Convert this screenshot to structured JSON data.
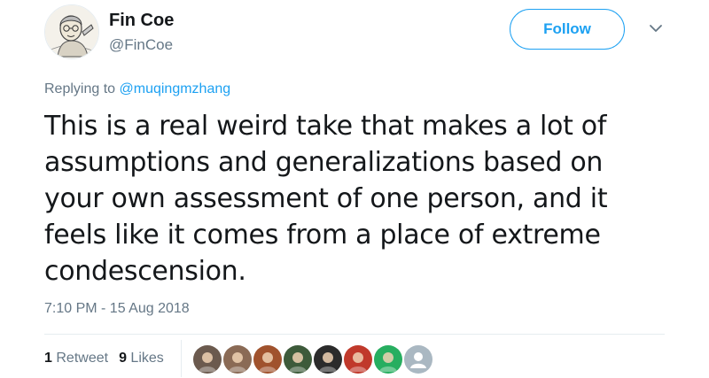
{
  "author": {
    "name": "Fin Coe",
    "handle": "@FinCoe",
    "avatar_icon": "sketched-portrait-avatar"
  },
  "follow_label": "Follow",
  "menu_icon": "chevron-down-icon",
  "reply": {
    "prefix": "Replying to",
    "to": "@muqingmzhang"
  },
  "tweet_text": "This is a real weird take that makes a lot of assumptions and generalizations based on your own assessment of one person, and it feels like it comes from a place of extreme condescension.",
  "timestamp": "7:10 PM - 15 Aug 2018",
  "stats": {
    "retweet_count": "1",
    "retweet_label": "Retweet",
    "like_count": "9",
    "like_label": "Likes"
  },
  "likers": [
    {
      "name": "liker-avatar-1",
      "color": "#6b5a4e"
    },
    {
      "name": "liker-avatar-2",
      "color": "#8a6a55"
    },
    {
      "name": "liker-avatar-3",
      "color": "#a0522d"
    },
    {
      "name": "liker-avatar-4",
      "color": "#3d5a3a"
    },
    {
      "name": "liker-avatar-5",
      "color": "#2b2b2b"
    },
    {
      "name": "liker-avatar-6",
      "color": "#c0392b"
    },
    {
      "name": "liker-avatar-7",
      "color": "#27ae60"
    },
    {
      "name": "liker-avatar-8",
      "color": "#aab8c2"
    }
  ],
  "colors": {
    "accent": "#1da1f2",
    "secondary_text": "#657786",
    "primary_text": "#14171a"
  }
}
